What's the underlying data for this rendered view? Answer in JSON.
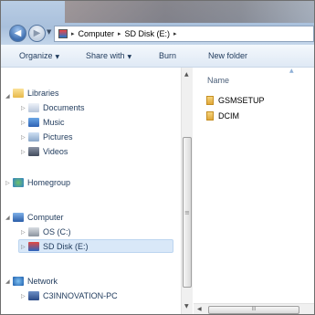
{
  "address": {
    "segments": [
      "Computer",
      "SD Disk (E:)"
    ],
    "separator": "▸"
  },
  "toolbar": {
    "organize": "Organize",
    "share_with": "Share with",
    "burn": "Burn",
    "new_folder": "New folder"
  },
  "nav": {
    "libraries": "Libraries",
    "documents": "Documents",
    "music": "Music",
    "pictures": "Pictures",
    "videos": "Videos",
    "homegroup": "Homegroup",
    "computer": "Computer",
    "os_c": "OS (C:)",
    "sd_disk": "SD Disk (E:)",
    "network": "Network",
    "pc": "C3INNOVATION-PC"
  },
  "content": {
    "column_name": "Name",
    "files": [
      "GSMSETUP",
      "DCIM"
    ]
  },
  "icons": {
    "back": "back-arrow-icon",
    "forward": "forward-arrow-icon",
    "folder": "folder-icon"
  },
  "colors": {
    "selection": "#d9e8f8",
    "toolbar_text": "#1e395b"
  }
}
